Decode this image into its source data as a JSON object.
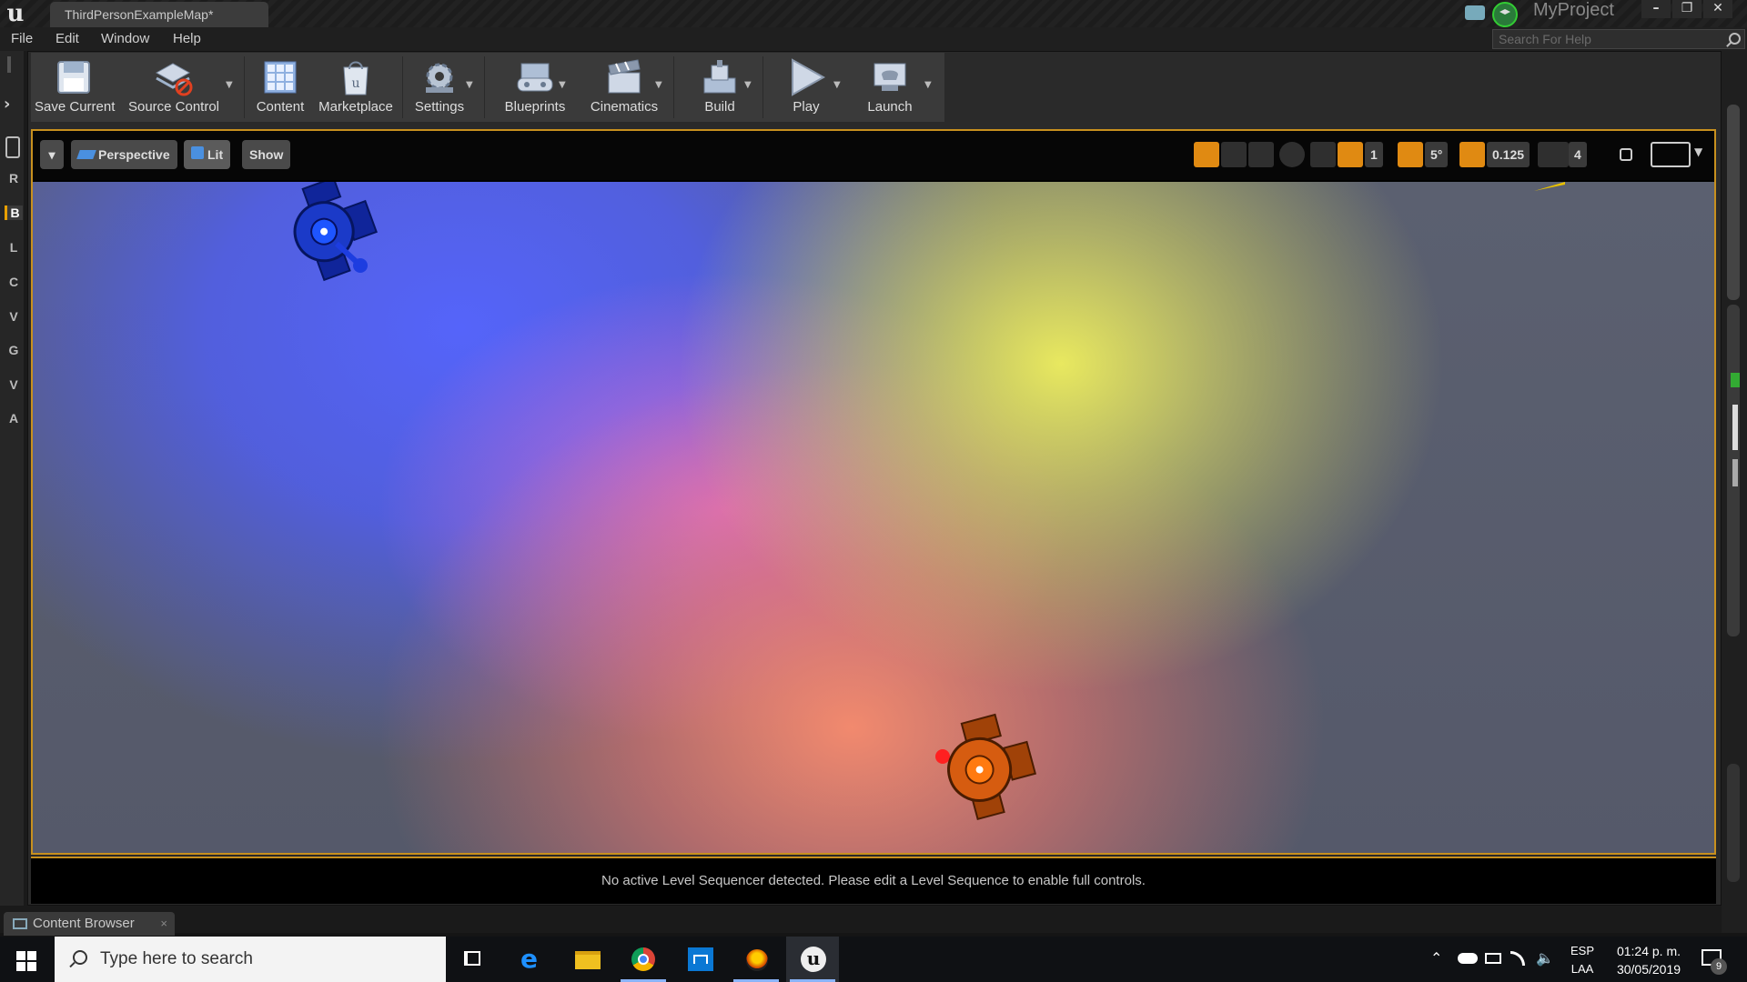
{
  "window": {
    "doc_tab": "ThirdPersonExampleMap*",
    "project_name": "MyProject",
    "controls": [
      "–",
      "❐",
      "✕"
    ]
  },
  "menu": {
    "items": [
      "File",
      "Edit",
      "Window",
      "Help"
    ],
    "help_search_placeholder": "Search For Help"
  },
  "left_tabs": [
    "R",
    "B",
    "L",
    "C",
    "V",
    "G",
    "V",
    "A"
  ],
  "toolbar": {
    "buttons": [
      {
        "label": "Save Current",
        "icon": "save-icon"
      },
      {
        "label": "Source Control",
        "icon": "source-control-icon"
      },
      {
        "label": "Content",
        "icon": "content-icon"
      },
      {
        "label": "Marketplace",
        "icon": "marketplace-icon"
      },
      {
        "label": "Settings",
        "icon": "settings-icon"
      },
      {
        "label": "Blueprints",
        "icon": "blueprints-icon"
      },
      {
        "label": "Cinematics",
        "icon": "cinematics-icon"
      },
      {
        "label": "Build",
        "icon": "build-icon"
      },
      {
        "label": "Play",
        "icon": "play-icon"
      },
      {
        "label": "Launch",
        "icon": "launch-icon"
      }
    ]
  },
  "viewport": {
    "view_mode": "Perspective",
    "lighting": "Lit",
    "show": "Show",
    "grid_snap": "1",
    "rotation_snap": "5°",
    "scale_snap": "0.125",
    "camera_speed": "4",
    "colors": {
      "frame": "#c8901e",
      "blue_light": "#1e3fd6",
      "orange_light": "#ff7a10"
    }
  },
  "sequencer_message": "No active Level Sequencer detected. Please edit a Level Sequence to enable full controls.",
  "content_browser": {
    "tab_label": "Content Browser",
    "close": "×"
  },
  "taskbar": {
    "search_placeholder": "Type here to search",
    "tray": {
      "lang_top": "ESP",
      "lang_bottom": "LAA",
      "time": "01:24 p. m.",
      "date": "30/05/2019",
      "notifications": "9"
    }
  }
}
